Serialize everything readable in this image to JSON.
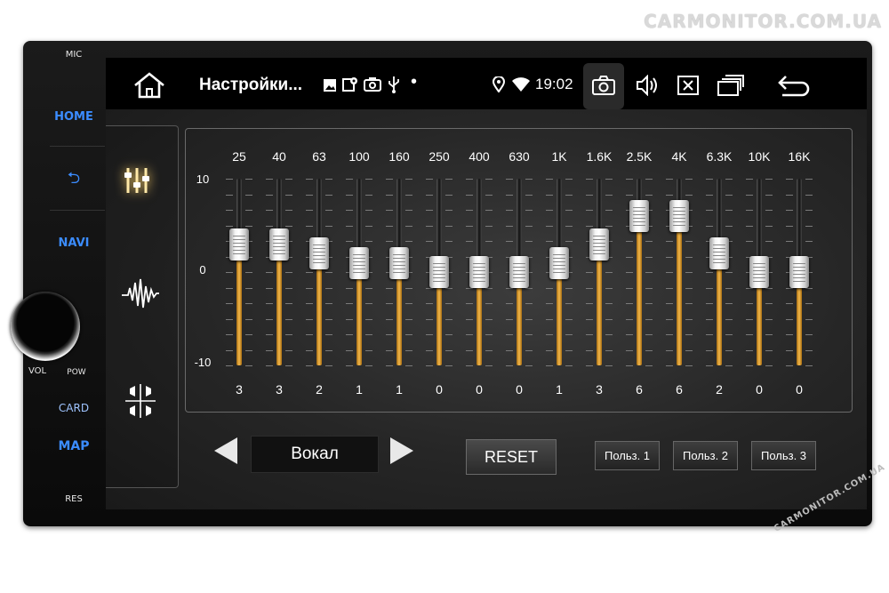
{
  "watermark": "CARMONITOR.COM.UA",
  "hardware": {
    "mic": "MIC",
    "home": "HOME",
    "navi": "NAVI",
    "vol": "VOL",
    "pow": "POW",
    "card": "CARD",
    "map": "MAP",
    "res": "RES"
  },
  "statusbar": {
    "title": "Настройки...",
    "time": "19:02",
    "icons": [
      "image-icon",
      "photo-location-icon",
      "camera-notification-icon",
      "usb-icon",
      "dot-icon",
      "location-icon",
      "wifi-icon"
    ]
  },
  "navbar": [
    "home-icon",
    "screenshot-icon",
    "volume-icon",
    "close-window-icon",
    "recent-apps-icon",
    "back-icon"
  ],
  "sidebar_tabs": [
    {
      "name": "equalizer-icon",
      "active": true
    },
    {
      "name": "sound-wave-icon",
      "active": false
    },
    {
      "name": "balance-fader-icon",
      "active": false
    }
  ],
  "equalizer": {
    "y_max": "10",
    "y_mid": "0",
    "y_min": "-10",
    "range": [
      -10,
      10
    ],
    "bands": [
      {
        "freq": "25",
        "value": "3"
      },
      {
        "freq": "40",
        "value": "3"
      },
      {
        "freq": "63",
        "value": "2"
      },
      {
        "freq": "100",
        "value": "1"
      },
      {
        "freq": "160",
        "value": "1"
      },
      {
        "freq": "250",
        "value": "0"
      },
      {
        "freq": "400",
        "value": "0"
      },
      {
        "freq": "630",
        "value": "0"
      },
      {
        "freq": "1K",
        "value": "1"
      },
      {
        "freq": "1.6K",
        "value": "3"
      },
      {
        "freq": "2.5K",
        "value": "6"
      },
      {
        "freq": "4K",
        "value": "6"
      },
      {
        "freq": "6.3K",
        "value": "2"
      },
      {
        "freq": "10K",
        "value": "0"
      },
      {
        "freq": "16K",
        "value": "0"
      }
    ]
  },
  "controls": {
    "preset": "Вокал",
    "reset": "RESET",
    "user1": "Польз. 1",
    "user2": "Польз. 2",
    "user3": "Польз. 3"
  },
  "colors": {
    "accent": "#f2b84b",
    "hardware_blue": "#3b8cff",
    "active_tab_glow": "#ffd36a"
  }
}
